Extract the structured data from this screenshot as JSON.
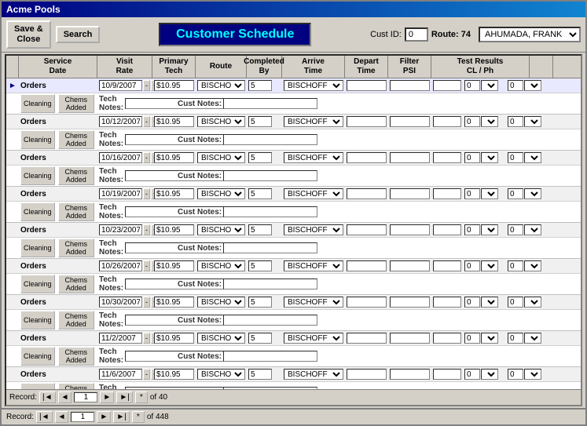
{
  "titleBar": {
    "label": "Acme Pools"
  },
  "toolbar": {
    "saveCloseLabel": "Save &\nClose",
    "searchLabel": "Search",
    "mainTitle": "Customer Schedule",
    "custIdLabel": "Cust ID:",
    "custIdValue": "0",
    "routeLabel": "Route:",
    "routeValue": "74",
    "custName": "AHUMADA, FRANK"
  },
  "gridHeader": {
    "col1": "",
    "col2": "Service\nDate",
    "col3": "Visit\nRate",
    "col4": "Primary\nTech",
    "col5": "Route",
    "col6": "Completed\nBy",
    "col7": "Arrive\nTime",
    "col8": "Depart\nTime",
    "col9": "Filter\nPSI",
    "col10": "Test Results\nCL / Ph",
    "col11": ""
  },
  "records": [
    {
      "date": "10/9/2007",
      "rate": "$10.95",
      "tech": "BISCHOFF M",
      "route": "5",
      "completed": "BISCHOFF",
      "techNotes": "",
      "custNotes": "",
      "clVal": "0",
      "phVal": "0",
      "selected": true
    },
    {
      "date": "10/12/2007",
      "rate": "$10.95",
      "tech": "BISCHOFF M",
      "route": "5",
      "completed": "BISCHOFF",
      "techNotes": "",
      "custNotes": "",
      "clVal": "0",
      "phVal": "0"
    },
    {
      "date": "10/16/2007",
      "rate": "$10.95",
      "tech": "BISCHOFF M",
      "route": "5",
      "completed": "BISCHOFF",
      "techNotes": "",
      "custNotes": "",
      "clVal": "0",
      "phVal": "0"
    },
    {
      "date": "10/19/2007",
      "rate": "$10.95",
      "tech": "BISCHOFF M",
      "route": "5",
      "completed": "BISCHOFF",
      "techNotes": "",
      "custNotes": "",
      "clVal": "0",
      "phVal": "0"
    },
    {
      "date": "10/23/2007",
      "rate": "$10.95",
      "tech": "BISCHOFF M",
      "route": "5",
      "completed": "BISCHOFF",
      "techNotes": "",
      "custNotes": "",
      "clVal": "0",
      "phVal": "0"
    },
    {
      "date": "10/26/2007",
      "rate": "$10.95",
      "tech": "BISCHOFF M",
      "route": "5",
      "completed": "BISCHOFF",
      "techNotes": "",
      "custNotes": "",
      "clVal": "0",
      "phVal": "0"
    },
    {
      "date": "10/30/2007",
      "rate": "$10.95",
      "tech": "BISCHOFF M",
      "route": "5",
      "completed": "BISCHOFF",
      "techNotes": "",
      "custNotes": "",
      "clVal": "0",
      "phVal": "0"
    },
    {
      "date": "11/2/2007",
      "rate": "$10.95",
      "tech": "BISCHOFF M",
      "route": "5",
      "completed": "BISCHOFF",
      "techNotes": "",
      "custNotes": "",
      "clVal": "0",
      "phVal": "0"
    },
    {
      "date": "11/6/2007",
      "rate": "$10.95",
      "tech": "BISCHOFF M",
      "route": "5",
      "completed": "BISCHOFF",
      "techNotes": "",
      "custNotes": "",
      "clVal": "0",
      "phVal": "0"
    }
  ],
  "buttons": {
    "cleaning": "Cleaning",
    "chemsAdded": "Chems Added",
    "techNotesLabel": "Tech Notes:",
    "custNotesLabel": "Cust Notes:",
    "ordersLabel": "Orders"
  },
  "innerNav": {
    "recordLabel": "Record:",
    "currentRecord": "1",
    "totalRecords": "40"
  },
  "outerNav": {
    "recordLabel": "Record:",
    "currentRecord": "1",
    "totalRecords": "448"
  }
}
